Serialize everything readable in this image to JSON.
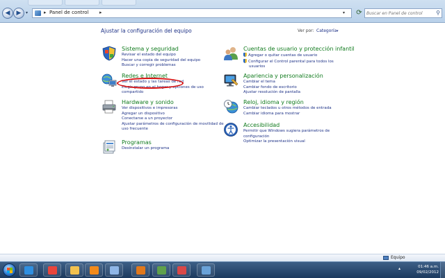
{
  "address_bar": {
    "crumb": "Panel de control",
    "crumb_separator": "▸",
    "crumb_arrow": "▸",
    "dropdown_glyph": "▾",
    "refresh_glyph": "⟳",
    "back_glyph": "◀",
    "forward_glyph": "▶",
    "recent_glyph": "▾"
  },
  "search": {
    "placeholder": "Buscar en Panel de control",
    "icon": "magnifier-icon"
  },
  "main": {
    "heading": "Ajustar la configuración del equipo",
    "view_by_label": "Ver por:",
    "view_by_value": "Categoría",
    "view_by_caret": "▾"
  },
  "categories": [
    {
      "title": "Sistema y seguridad",
      "icon": "shield-flag-icon",
      "links": [
        "Revisar el estado del equipo",
        "Hacer una copia de seguridad del equipo",
        "Buscar y corregir problemas"
      ]
    },
    {
      "title": "Redes e Internet",
      "icon": "network-globe-icon",
      "links": [
        "Ver el estado y las tareas de red",
        "Elegir grupo en el hogar y opciones de uso",
        "compartido"
      ]
    },
    {
      "title": "Hardware y sonido",
      "icon": "printer-icon",
      "links": [
        "Ver dispositivos e impresoras",
        "Agregar un dispositivo",
        "Conectarse a un proyector",
        "Ajustar parámetros de configuración de movilidad de",
        "uso frecuente"
      ]
    },
    {
      "title": "Programas",
      "icon": "programs-box-icon",
      "links": [
        "Desinstalar un programa"
      ]
    },
    {
      "title": "Cuentas de usuario y protección infantil",
      "icon": "users-icon",
      "links": [
        "Agregar o quitar cuentas de usuario",
        "Configurar el Control parental para todos los",
        "usuarios"
      ]
    },
    {
      "title": "Apariencia y personalización",
      "icon": "monitor-paint-icon",
      "links": [
        "Cambiar el tema",
        "Cambiar fondo de escritorio",
        "Ajustar resolución de pantalla"
      ]
    },
    {
      "title": "Reloj, idioma y región",
      "icon": "clock-globe-icon",
      "links": [
        "Cambiar teclados u otros métodos de entrada",
        "Cambiar idioma para mostrar"
      ]
    },
    {
      "title": "Accesibilidad",
      "icon": "ease-of-access-icon",
      "links": [
        "Permitir que Windows sugiera parámetros de",
        "configuración",
        "Optimizar la presentación visual"
      ]
    }
  ],
  "status_bar": {
    "location": "Equipo"
  },
  "taskbar": {
    "apps": [
      {
        "name": "internet-explorer-icon",
        "color": "#2f8fe0"
      },
      {
        "name": "chrome-icon",
        "color": "#e8453c"
      },
      {
        "name": "file-explorer-icon",
        "color": "#f2c14e"
      },
      {
        "name": "media-player-icon",
        "color": "#f28a1a"
      },
      {
        "name": "control-panel-icon",
        "color": "#8fb6e6"
      },
      {
        "name": "matlab-icon",
        "color": "#e0781c"
      },
      {
        "name": "media-encoder-icon",
        "color": "#5fa04b"
      },
      {
        "name": "utility-app-icon",
        "color": "#d94848"
      },
      {
        "name": "control-panel-active-icon",
        "color": "#6aa2d8"
      }
    ],
    "tray_glyph": "▴",
    "time": "01:46 a.m.",
    "date": "09/02/2012"
  }
}
